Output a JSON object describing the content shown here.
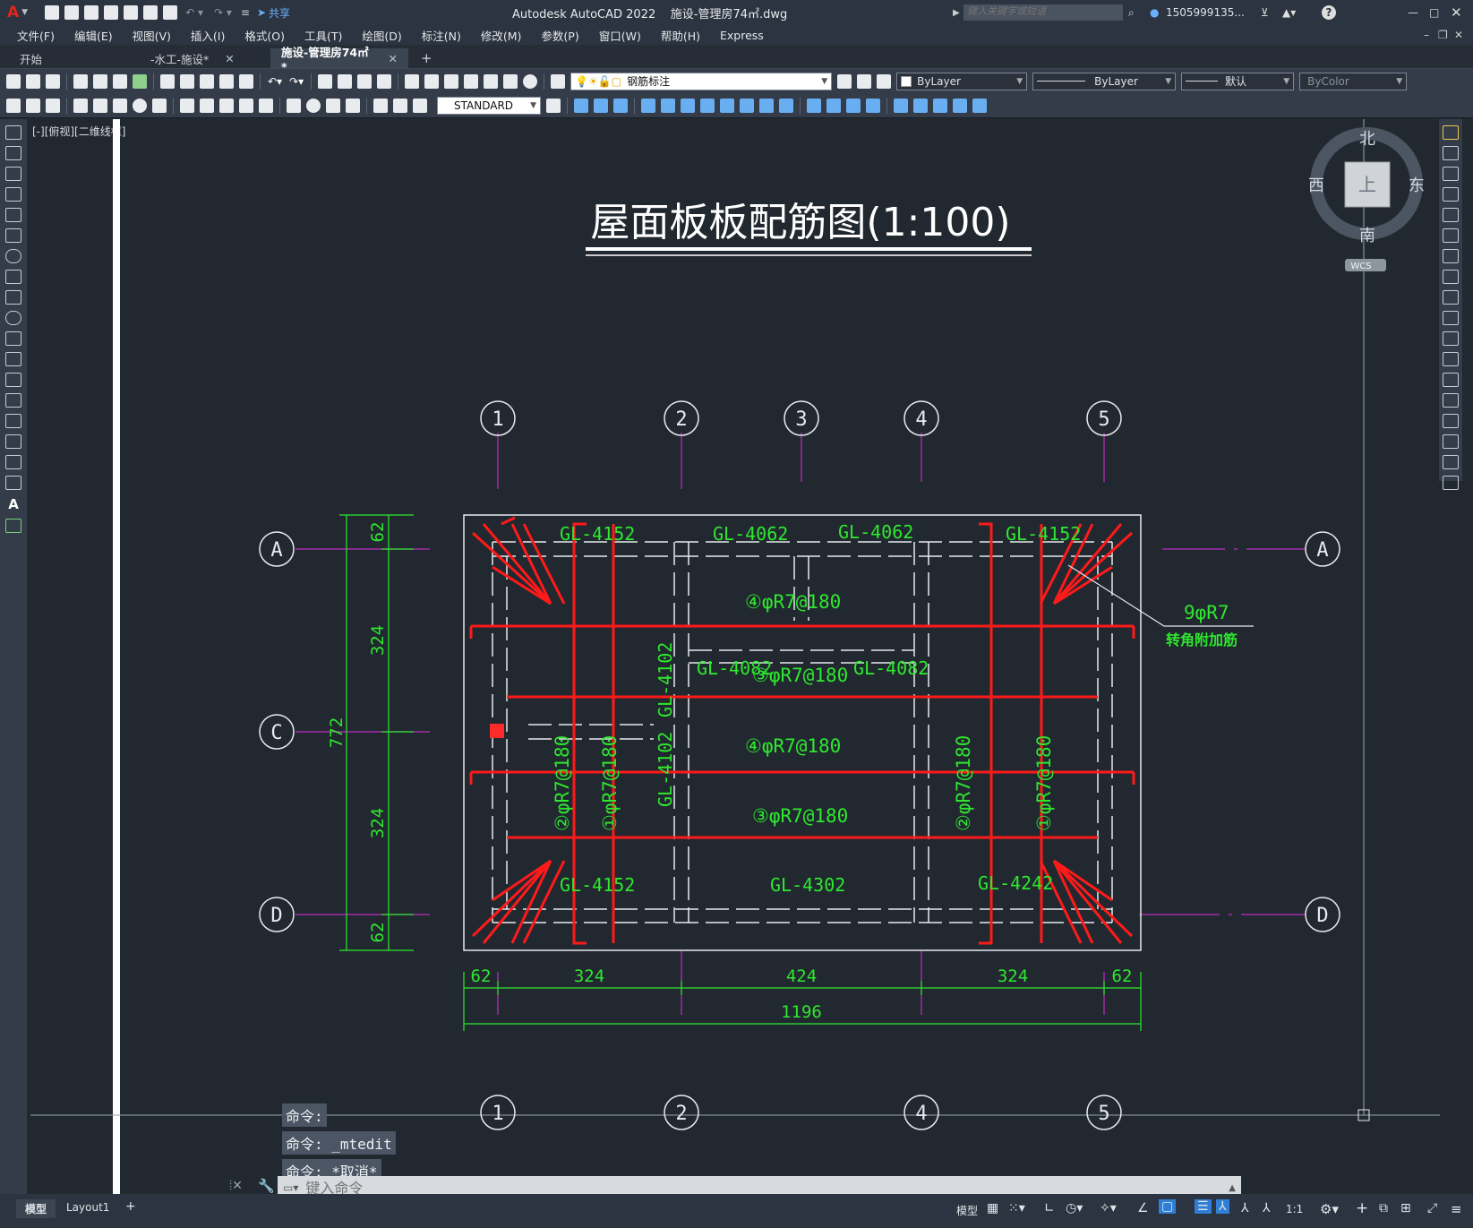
{
  "app": {
    "title": "Autodesk AutoCAD 2022    施设-管理房74㎡.dwg",
    "share_label": "共享",
    "search_placeholder": "键入关键字或短语",
    "user": "1505999135...",
    "help": "?"
  },
  "menu": [
    "文件(F)",
    "编辑(E)",
    "视图(V)",
    "插入(I)",
    "格式(O)",
    "工具(T)",
    "绘图(D)",
    "标注(N)",
    "修改(M)",
    "参数(P)",
    "窗口(W)",
    "帮助(H)",
    "Express"
  ],
  "tabs": [
    {
      "label": "开始",
      "closable": false,
      "active": false
    },
    {
      "label": "-水工-施设*",
      "closable": true,
      "active": false
    },
    {
      "label": "施设-管理房74㎡*",
      "closable": true,
      "active": true
    }
  ],
  "toolbar": {
    "layer": "钢筋标注",
    "color": "ByLayer",
    "linetype": "ByLayer",
    "lineweight": "默认",
    "plotstyle": "ByColor",
    "textstyle": "STANDARD"
  },
  "viewport_label": "[-][俯视][二维线框]",
  "viewcube": {
    "north": "北",
    "south": "南",
    "east": "东",
    "west": "西",
    "top": "上",
    "wcs": "WCS"
  },
  "drawing": {
    "title": "屋面板板配筋图(1:100)",
    "grid_numbers": [
      "1",
      "2",
      "3",
      "4",
      "5"
    ],
    "grid_letters": [
      "A",
      "C",
      "D"
    ],
    "beams": [
      "GL-4152",
      "GL-4062",
      "GL-4062",
      "GL-4152",
      "GL-4082",
      "GL-4082",
      "GL-4102",
      "GL-4102",
      "GL-4152",
      "GL-4302",
      "GL-4242"
    ],
    "rebar_labels": {
      "r4": "④φR7@180",
      "r3": "③φR7@180",
      "r2": "②φR7@180",
      "r1": "①φR7@180"
    },
    "corner_bar": "9φR7",
    "corner_note": "转角附加筋",
    "dims_h": [
      "62",
      "324",
      "424",
      "324",
      "62"
    ],
    "dims_total_h": "1196",
    "dims_v": [
      "62",
      "324",
      "324",
      "62"
    ],
    "dims_total_v": "772"
  },
  "command": {
    "history": [
      "命令:",
      "命令: _mtedit",
      "命令: *取消*"
    ],
    "placeholder": "键入命令"
  },
  "status": {
    "tab_model": "模型",
    "tab_layout": "Layout1",
    "model_btn": "模型",
    "scale": "1:1"
  }
}
